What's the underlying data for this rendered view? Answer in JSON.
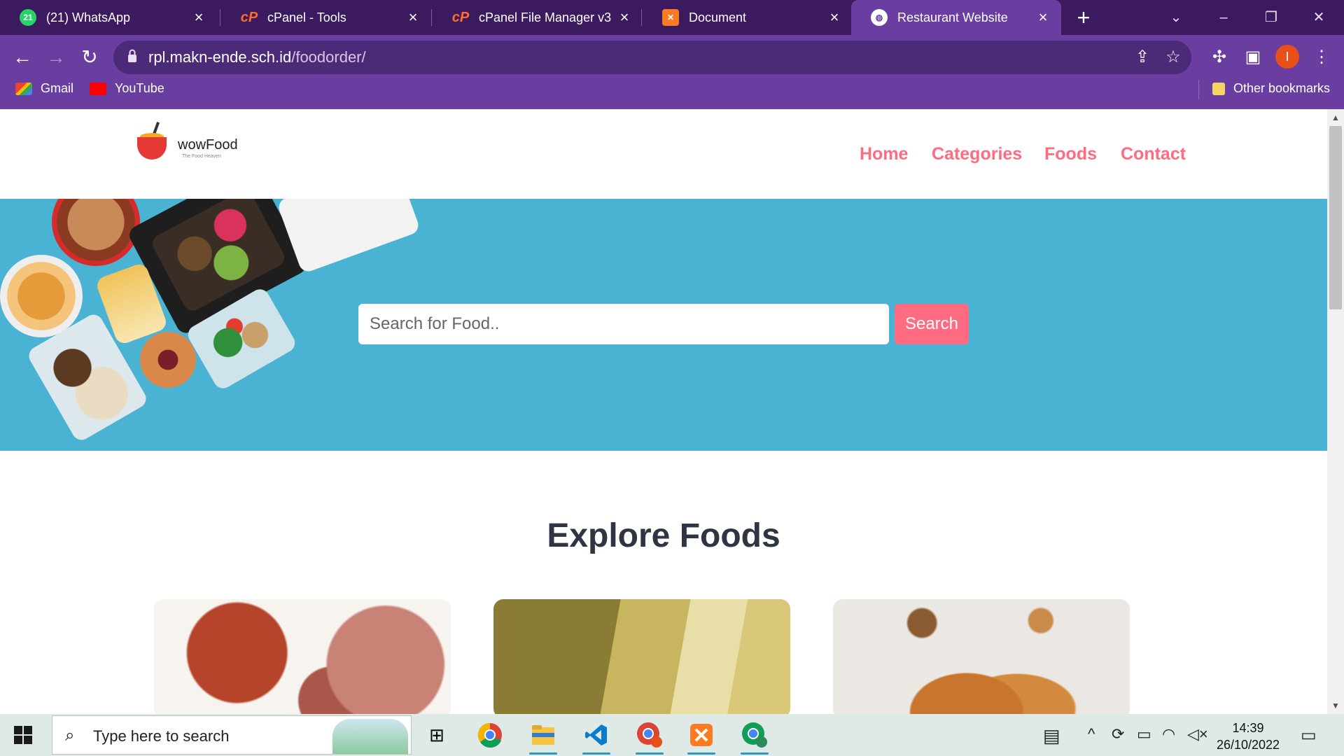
{
  "browser": {
    "tabs": [
      {
        "title": "(21) WhatsApp",
        "favicon": "whatsapp-icon",
        "badge": "21",
        "active": false
      },
      {
        "title": "cPanel - Tools",
        "favicon": "cpanel-icon",
        "active": false
      },
      {
        "title": "cPanel File Manager v3",
        "favicon": "cpanel-icon",
        "active": false
      },
      {
        "title": "Document",
        "favicon": "xampp-icon",
        "active": false
      },
      {
        "title": "Restaurant Website",
        "favicon": "globe-icon",
        "active": true
      }
    ],
    "url_host": "rpl.makn-ende.sch.id",
    "url_path": "/foodorder/",
    "profile_initial": "I",
    "bookmarks": [
      {
        "label": "Gmail",
        "icon": "gmail-icon"
      },
      {
        "label": "YouTube",
        "icon": "youtube-icon"
      }
    ],
    "other_bookmarks": "Other bookmarks"
  },
  "site": {
    "logo_name": "wowFood",
    "logo_tagline": "The Food Heaven",
    "nav": [
      "Home",
      "Categories",
      "Foods",
      "Contact"
    ],
    "search_placeholder": "Search for Food..",
    "search_button": "Search",
    "section_title": "Explore Foods",
    "colors": {
      "accent": "#ff6b81",
      "hero_bg": "#4ab3d3",
      "heading": "#2f3542"
    }
  },
  "taskbar": {
    "search_placeholder": "Type here to search",
    "apps": [
      "task-view-icon",
      "chrome-icon",
      "file-explorer-icon",
      "vscode-icon",
      "chrome-profile-icon",
      "xampp-icon",
      "chrome-profile-m-icon"
    ],
    "time": "14:39",
    "date": "26/10/2022"
  }
}
